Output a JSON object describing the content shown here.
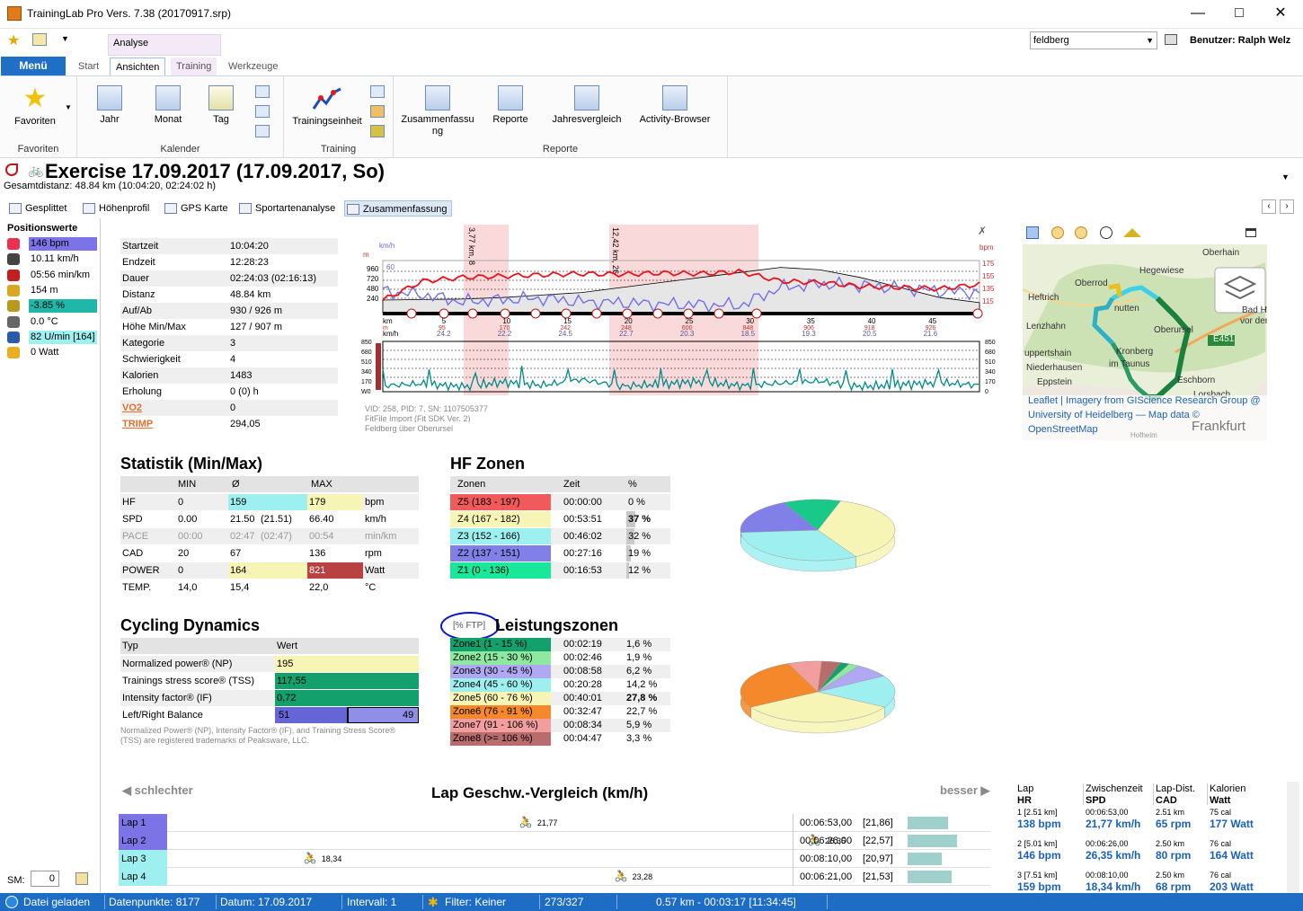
{
  "window": {
    "title": "TrainingLab Pro Vers. 7.38 (20170917.srp)"
  },
  "ribbon": {
    "context_label": "Analyse",
    "menu_label": "Menü",
    "tabs": [
      "Start",
      "Ansichten",
      "Training",
      "Werkzeuge"
    ],
    "location_select": "feldberg",
    "user": "Benutzer: Ralph Welz",
    "groups": {
      "favoriten": {
        "label": "Favoriten",
        "button": "Favoriten"
      },
      "kalender": {
        "label": "Kalender",
        "buttons": [
          "Jahr",
          "Monat",
          "Tag"
        ]
      },
      "training": {
        "label": "Training",
        "button": "Trainingseinheit"
      },
      "reporte": {
        "label": "Reporte",
        "buttons": [
          "Zusammenfassu\nng",
          "Reporte",
          "Jahresvergleich",
          "Activity-Browser"
        ]
      }
    }
  },
  "header": {
    "title": "Exercise 17.09.2017 (17.09.2017, So)",
    "subtitle": "Gesamtdistanz: 48.84 km (10:04:20, 02:24:02 h)"
  },
  "subtabs": [
    "Gesplittet",
    "Höhenprofil",
    "GPS Karte",
    "Sportartenanalyse",
    "Zusammenfassung"
  ],
  "positionswerte": {
    "title": "Positionswerte",
    "items": [
      {
        "text": "146 bpm",
        "bg": "#7b73e6",
        "icon": "heart-icon"
      },
      {
        "text": "10.11 km/h",
        "bg": "",
        "icon": "speedometer-icon"
      },
      {
        "text": "05:56 min/km",
        "bg": "",
        "icon": "runner-icon"
      },
      {
        "text": "154 m",
        "bg": "",
        "icon": "altitude-icon"
      },
      {
        "text": "-3.85 %",
        "bg": "#1fb8a8",
        "icon": "gradient-icon"
      },
      {
        "text": "0.0 °C",
        "bg": "",
        "icon": "thermometer-icon"
      },
      {
        "text": "82 U/min [164]",
        "bg": "#9ff0f0",
        "icon": "cadence-icon"
      },
      {
        "text": "0 Watt",
        "bg": "",
        "icon": "lightning-icon"
      }
    ],
    "sm_label": "SM:",
    "sm_value": "0"
  },
  "info": [
    [
      "Startzeit",
      "10:04:20"
    ],
    [
      "Endzeit",
      "12:28:23"
    ],
    [
      "Dauer",
      "02:24:03 (02:16:13)"
    ],
    [
      "Distanz",
      "48.84 km"
    ],
    [
      "Auf/Ab",
      "930 / 926 m"
    ],
    [
      "Höhe Min/Max",
      "127 / 907 m"
    ],
    [
      "Kategorie",
      "3"
    ],
    [
      "Schwierigkeit",
      "4"
    ],
    [
      "Kalorien",
      "1483"
    ],
    [
      "Erholung",
      "0 (0) h"
    ],
    [
      "VO2",
      "0"
    ],
    [
      "TRIMP",
      "294,05"
    ]
  ],
  "chart_info": {
    "line1": "VID: 258, PID: 7, SN: 1107505377",
    "line2": "FitFile Import (Fit SDK Ver. 2)",
    "line3": "Feldberg über Oberursel",
    "lap_label_1": "3,77 km, 8",
    "lap_label_2": "12,42 km, 26"
  },
  "chart_data": [
    {
      "type": "line",
      "title": "",
      "xlabel": "km",
      "x_ticks": [
        "0",
        "5",
        "10",
        "15",
        "20",
        "25",
        "30",
        "35",
        "40",
        "45"
      ],
      "y_left_label": "km/h",
      "y_left_ticks": [
        "60"
      ],
      "y_left2_label": "m",
      "y_left2_ticks": [
        "960",
        "720",
        "480",
        "240"
      ],
      "y_right_label": "bpm",
      "y_right_ticks": [
        "175",
        "155",
        "135",
        "115"
      ],
      "speed_row": [
        "24.2",
        "22.2",
        "24.5",
        "22.7",
        "20.3",
        "18.5",
        "19.3",
        "20.5",
        "21.6"
      ],
      "alt_row": [
        "95",
        "170",
        "242",
        "248",
        "600",
        "848",
        "906",
        "918",
        "926"
      ],
      "series": [
        {
          "name": "HR",
          "color": "#e8141c",
          "values": [
            120,
            150,
            156,
            158,
            160,
            162,
            161,
            163,
            162,
            165,
            150,
            148,
            142,
            140,
            138,
            145
          ]
        },
        {
          "name": "Speed",
          "color": "#7070e8",
          "values": [
            30,
            25,
            15,
            18,
            20,
            15,
            14,
            12,
            11,
            10,
            35,
            40,
            38,
            35,
            30,
            28
          ]
        },
        {
          "name": "Altitude",
          "color": "#000000",
          "values": [
            250,
            260,
            270,
            300,
            350,
            400,
            500,
            600,
            700,
            800,
            900,
            850,
            700,
            500,
            300,
            200
          ]
        }
      ]
    },
    {
      "type": "line",
      "title": "",
      "y_left_ticks": [
        "850",
        "680",
        "510",
        "340",
        "170",
        "W0"
      ],
      "y_right_ticks": [
        "850",
        "680",
        "510",
        "340",
        "170",
        "0"
      ],
      "series": [
        {
          "name": "Power",
          "color": "#008a8a",
          "values": [
            80,
            120,
            60,
            150,
            90,
            200,
            70,
            110,
            160,
            80,
            130,
            170,
            60,
            100,
            140,
            90
          ]
        }
      ]
    },
    {
      "type": "pie",
      "title": "HF Zonen",
      "categories": [
        "Z5",
        "Z4",
        "Z3",
        "Z2",
        "Z1"
      ],
      "values": [
        0,
        37,
        32,
        19,
        12
      ],
      "colors": [
        "#f05a5a",
        "#f7f5b5",
        "#9ef0f0",
        "#8080e8",
        "#19c98a"
      ]
    },
    {
      "type": "pie",
      "title": "Leistungszonen",
      "categories": [
        "Zone1",
        "Zone2",
        "Zone3",
        "Zone4",
        "Zone5",
        "Zone6",
        "Zone7",
        "Zone8"
      ],
      "values": [
        1.6,
        1.9,
        6.2,
        14.2,
        27.8,
        22.7,
        5.9,
        3.3
      ],
      "colors": [
        "#14a06c",
        "#8fe89f",
        "#b0a8f2",
        "#9ef0f0",
        "#f7f5b5",
        "#f4882a",
        "#f29e9e",
        "#b86c6c"
      ]
    },
    {
      "type": "bar",
      "title": "Lap Geschw.-Vergleich (km/h)",
      "categories": [
        "Lap 1",
        "Lap 2",
        "Lap 3",
        "Lap 4"
      ],
      "values": [
        21.77,
        26.35,
        18.34,
        23.28
      ]
    }
  ],
  "map": {
    "labels": [
      "Oberhain",
      "Hegewiese",
      "Oberrod",
      "Heftrich",
      "nutten",
      "Bad Hc",
      "vor der",
      "Lenzhahn",
      "Oberursel",
      "E451",
      "uppertshain",
      "Kronberg",
      "im Taunus",
      "Niederhausen",
      "Eppstein",
      "Eschborn",
      "Lorsbach",
      "Frankfurt"
    ],
    "attribution_1": "Leaflet | Imagery from GIScience Research Group @",
    "attribution_2": "University of Heidelberg — Map data ©",
    "attribution_3": "OpenStreetMap",
    "attribution_4": "Hofheim"
  },
  "statistik": {
    "title": "Statistik (Min/Max)",
    "headers": [
      "",
      "MIN",
      "Ø",
      "MAX",
      ""
    ],
    "rows": [
      {
        "name": "HF",
        "min": "0",
        "avg": "159",
        "avg2": "",
        "max": "179",
        "unit": "bpm",
        "avg_bg": "#9ef0f0",
        "max_bg": "#f7f5b5",
        "grey": false
      },
      {
        "name": "SPD",
        "min": "0.00",
        "avg": "21.50",
        "avg2": "(21.51)",
        "max": "66.40",
        "unit": "km/h",
        "avg_bg": "",
        "max_bg": "",
        "grey": false
      },
      {
        "name": "PACE",
        "min": "00:00",
        "avg": "02:47",
        "avg2": "(02:47)",
        "max": "00:54",
        "unit": "min/km",
        "avg_bg": "",
        "max_bg": "",
        "grey": true
      },
      {
        "name": "CAD",
        "min": "20",
        "avg": "67",
        "avg2": "",
        "max": "136",
        "unit": "rpm",
        "avg_bg": "",
        "max_bg": "",
        "grey": false
      },
      {
        "name": "POWER",
        "min": "0",
        "avg": "164",
        "avg2": "",
        "max": "821",
        "unit": "Watt",
        "avg_bg": "#f7f5b5",
        "max_bg": "#b84242",
        "grey": false
      },
      {
        "name": "TEMP.",
        "min": "14,0",
        "avg": "15,4",
        "avg2": "",
        "max": "22,0",
        "unit": "°C",
        "avg_bg": "",
        "max_bg": "",
        "grey": false
      }
    ]
  },
  "hfzonen": {
    "title": "HF Zonen",
    "headers": [
      "Zonen",
      "Zeit",
      "%"
    ],
    "rows": [
      {
        "zone": "Z5 (183 - 197)",
        "time": "00:00:00",
        "pct": "0 %",
        "bold": false,
        "pct_num": 0,
        "color": "#f05a5a"
      },
      {
        "zone": "Z4 (167 - 182)",
        "time": "00:53:51",
        "pct": "37 %",
        "bold": true,
        "pct_num": 37,
        "color": "#f7f5b5"
      },
      {
        "zone": "Z3 (152 - 166)",
        "time": "00:46:02",
        "pct": "32 %",
        "bold": false,
        "pct_num": 32,
        "color": "#9ef0f0"
      },
      {
        "zone": "Z2 (137 - 151)",
        "time": "00:27:16",
        "pct": "19 %",
        "bold": false,
        "pct_num": 19,
        "color": "#8080e8"
      },
      {
        "zone": "Z1 (0 - 136)",
        "time": "00:16:53",
        "pct": "12 %",
        "bold": false,
        "pct_num": 12,
        "color": "#19e89a"
      }
    ]
  },
  "cycling": {
    "title": "Cycling Dynamics",
    "headers": [
      "Typ",
      "Wert"
    ],
    "rows": [
      {
        "name": "Normalized power® (NP)",
        "value": "195",
        "bg": "#f7f5b5"
      },
      {
        "name": "Trainings stress score® (TSS)",
        "value": "117,55",
        "bg": "#14a06c"
      },
      {
        "name": "Intensity factor® (IF)",
        "value": "0,72",
        "bg": "#14a06c"
      }
    ],
    "lr_label": "Left/Right Balance",
    "lr_left": "51",
    "lr_right": "49",
    "lr_left_pct": 51,
    "note": "Normalized Power® (NP), Intensity Factor® (IF), and Training Stress Score® (TSS) are registered trademarks of Peaksware, LLC."
  },
  "leistung": {
    "title": "Leistungszonen",
    "ftp_label": "[% FTP]",
    "rows": [
      {
        "zone": "Zone1 (1 - 15 %)",
        "time": "00:02:19",
        "pct": "1,6 %",
        "bold": false,
        "color": "#14a06c",
        "pct_num": 1.6
      },
      {
        "zone": "Zone2 (15 - 30 %)",
        "time": "00:02:46",
        "pct": "1,9 %",
        "bold": false,
        "color": "#8fe89f",
        "pct_num": 1.9
      },
      {
        "zone": "Zone3 (30 - 45 %)",
        "time": "00:08:58",
        "pct": "6,2 %",
        "bold": false,
        "color": "#b0a8f2",
        "pct_num": 6.2
      },
      {
        "zone": "Zone4 (45 - 60 %)",
        "time": "00:20:28",
        "pct": "14,2 %",
        "bold": false,
        "color": "#9ef0f0",
        "pct_num": 14.2
      },
      {
        "zone": "Zone5 (60 - 76 %)",
        "time": "00:40:01",
        "pct": "27,8 %",
        "bold": true,
        "color": "#f7f5b5",
        "pct_num": 27.8
      },
      {
        "zone": "Zone6 (76 - 91 %)",
        "time": "00:32:47",
        "pct": "22,7 %",
        "bold": false,
        "color": "#f4882a",
        "pct_num": 22.7
      },
      {
        "zone": "Zone7 (91 - 106 %)",
        "time": "00:08:34",
        "pct": "5,9 %",
        "bold": false,
        "color": "#f29e9e",
        "pct_num": 5.9
      },
      {
        "zone": "Zone8 (>= 106 %)",
        "time": "00:04:47",
        "pct": "3,3 %",
        "bold": false,
        "color": "#b86c6c",
        "pct_num": 3.3
      }
    ]
  },
  "lapcompare": {
    "title": "Lap Geschw.-Vergleich (km/h)",
    "worse": "schlechter",
    "better": "besser",
    "laps": [
      {
        "name": "Lap 1",
        "value": "21,77",
        "time": "00:06:53,00",
        "bracket": "[21,86]",
        "color": "#7b73e6",
        "speed": 21.77
      },
      {
        "name": "Lap 2",
        "value": "26,35",
        "time": "00:06:26,00",
        "bracket": "[22,57]",
        "color": "#7b73e6",
        "speed": 26.35
      },
      {
        "name": "Lap 3",
        "value": "18,34",
        "time": "00:08:10,00",
        "bracket": "[20,97]",
        "color": "#9ef0f0",
        "speed": 18.34
      },
      {
        "name": "Lap 4",
        "value": "23,28",
        "time": "00:06:21,00",
        "bracket": "[21,53]",
        "color": "#9ef0f0",
        "speed": 23.28
      }
    ]
  },
  "laptable": {
    "headers": [
      {
        "top": "Lap",
        "bot": "HR"
      },
      {
        "top": "Zwischenzeit",
        "bot": "SPD"
      },
      {
        "top": "Lap-Dist.",
        "bot": "CAD"
      },
      {
        "top": "Kalorien",
        "bot": "Watt"
      }
    ],
    "rows": [
      {
        "lap": "1  [2.51 km]",
        "time": "00:06:53,00",
        "dist": "2.51 km",
        "cal": "75 cal",
        "hr": "138 bpm",
        "spd": "21,77 km/h",
        "cad": "65 rpm",
        "watt": "177 Watt"
      },
      {
        "lap": "2  [5.01 km]",
        "time": "00:06:26,00",
        "dist": "2.50 km",
        "cal": "76 cal",
        "hr": "146 bpm",
        "spd": "26,35 km/h",
        "cad": "80 rpm",
        "watt": "164 Watt"
      },
      {
        "lap": "3  [7.51 km]",
        "time": "00:08:10,00",
        "dist": "2.50 km",
        "cal": "76 cal",
        "hr": "159 bpm",
        "spd": "18,34 km/h",
        "cad": "68 rpm",
        "watt": "203 Watt"
      }
    ]
  },
  "status": {
    "file": "Datei geladen",
    "points": "Datenpunkte: 8177",
    "date": "Datum: 17.09.2017",
    "interval": "Intervall: 1",
    "filter": "Filter: Keiner",
    "range": "273/327",
    "position": "0.57 km - 00:03:17 [11:34:45]"
  }
}
